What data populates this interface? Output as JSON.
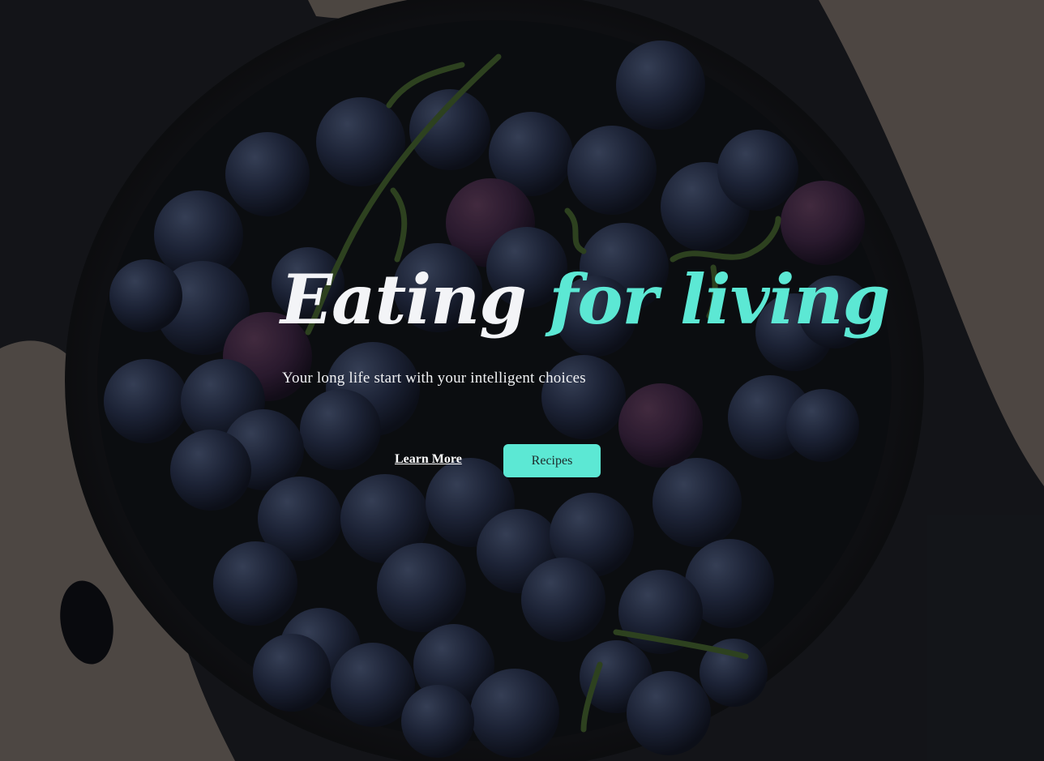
{
  "hero": {
    "title_part1": "Eating",
    "title_part2": "for living",
    "subtitle": "Your long life start with your intelligent choices",
    "learn_more_label": "Learn More",
    "recipes_label": "Recipes",
    "background_image": "bowl-of-grapes-photo",
    "colors": {
      "accent": "#5ce8d4",
      "text": "#f3f4f7",
      "overlay": "#000000"
    }
  }
}
